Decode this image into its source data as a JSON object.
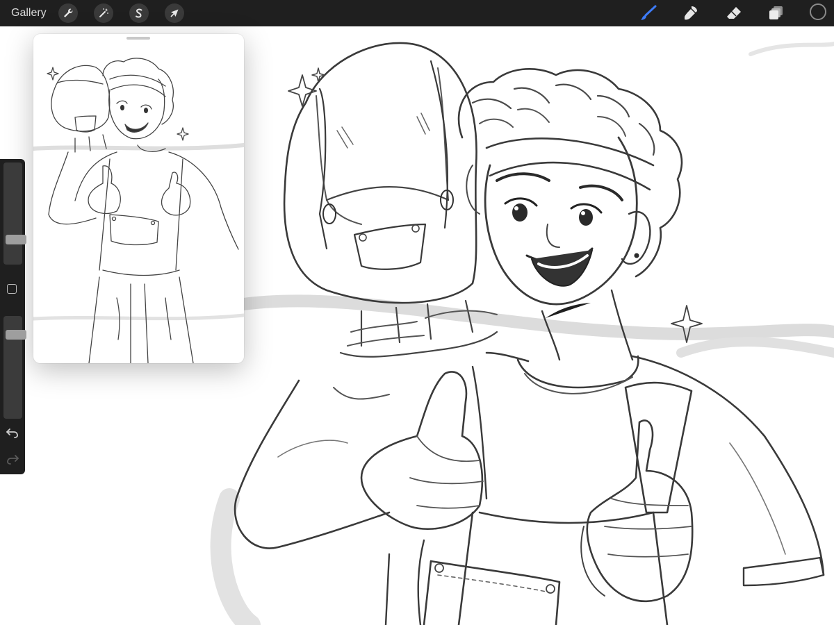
{
  "topbar": {
    "gallery_label": "Gallery",
    "left_tools": [
      {
        "name": "actions",
        "icon": "wrench-icon"
      },
      {
        "name": "adjustments",
        "icon": "magic-wand-icon"
      },
      {
        "name": "selection",
        "icon": "selection-s-icon"
      },
      {
        "name": "transform",
        "icon": "arrow-cursor-icon"
      }
    ],
    "right_tools": [
      {
        "name": "brush",
        "icon": "brush-icon",
        "active": true
      },
      {
        "name": "smudge",
        "icon": "smudge-icon",
        "active": false
      },
      {
        "name": "eraser",
        "icon": "eraser-icon",
        "active": false
      },
      {
        "name": "layers",
        "icon": "layers-icon",
        "active": false
      }
    ],
    "color": "#1f1f1f"
  },
  "sidebar": {
    "brush_size": 0.22,
    "brush_opacity": 0.85,
    "icons": [
      "modify-square-icon",
      "undo-icon",
      "redo-icon"
    ]
  },
  "colors": {
    "accent": "#3d7bf7",
    "toolbar_bg": "#1f1f1f",
    "sketch_line": "#3a3a3a",
    "sketch_shadow": "#d6d6d6"
  }
}
